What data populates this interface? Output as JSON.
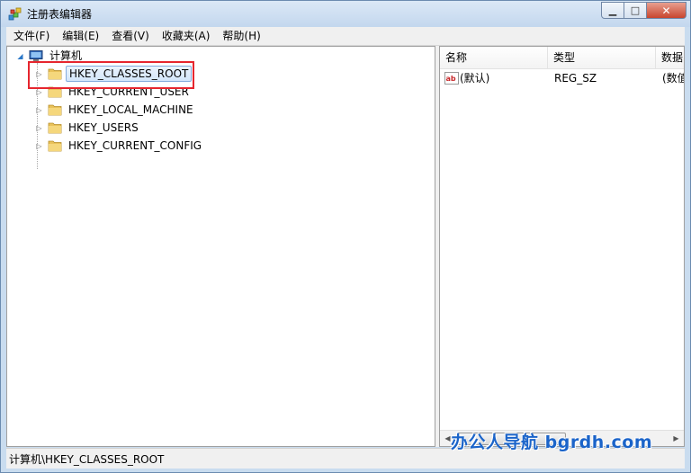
{
  "window": {
    "title": "注册表编辑器"
  },
  "menu": {
    "items": [
      "文件(F)",
      "编辑(E)",
      "查看(V)",
      "收藏夹(A)",
      "帮助(H)"
    ]
  },
  "tree": {
    "root_label": "计算机",
    "keys": [
      "HKEY_CLASSES_ROOT",
      "HKEY_CURRENT_USER",
      "HKEY_LOCAL_MACHINE",
      "HKEY_USERS",
      "HKEY_CURRENT_CONFIG"
    ],
    "selected_index": 0
  },
  "list": {
    "columns": [
      "名称",
      "类型",
      "数据"
    ],
    "rows": [
      {
        "name": "(默认)",
        "type": "REG_SZ",
        "data": "(数值"
      }
    ]
  },
  "status": {
    "path": "计算机\\HKEY_CLASSES_ROOT"
  },
  "watermark": {
    "text": "办公人导航 bgrdh.com"
  },
  "colors": {
    "highlight_border": "#e6262e",
    "watermark": "#1b64c9",
    "selection": "#d3e6fa"
  }
}
